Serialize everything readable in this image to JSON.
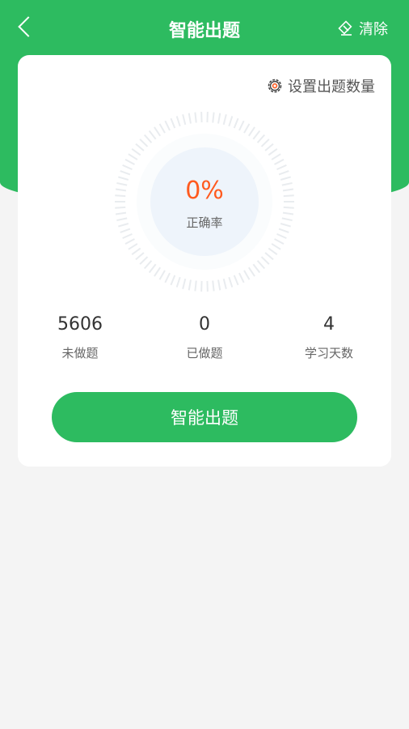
{
  "header": {
    "title": "智能出题",
    "clear_label": "清除"
  },
  "card": {
    "settings_label": "设置出题数量",
    "accuracy": {
      "value": "0%",
      "label": "正确率"
    },
    "stats": [
      {
        "value": "5606",
        "label": "未做题"
      },
      {
        "value": "0",
        "label": "已做题"
      },
      {
        "value": "4",
        "label": "学习天数"
      }
    ],
    "button_label": "智能出题"
  },
  "colors": {
    "primary": "#2dbb60",
    "accent": "#ff5a1f",
    "background": "#f4f4f4"
  },
  "icons": [
    "back-arrow-icon",
    "eraser-icon",
    "gear-icon"
  ]
}
